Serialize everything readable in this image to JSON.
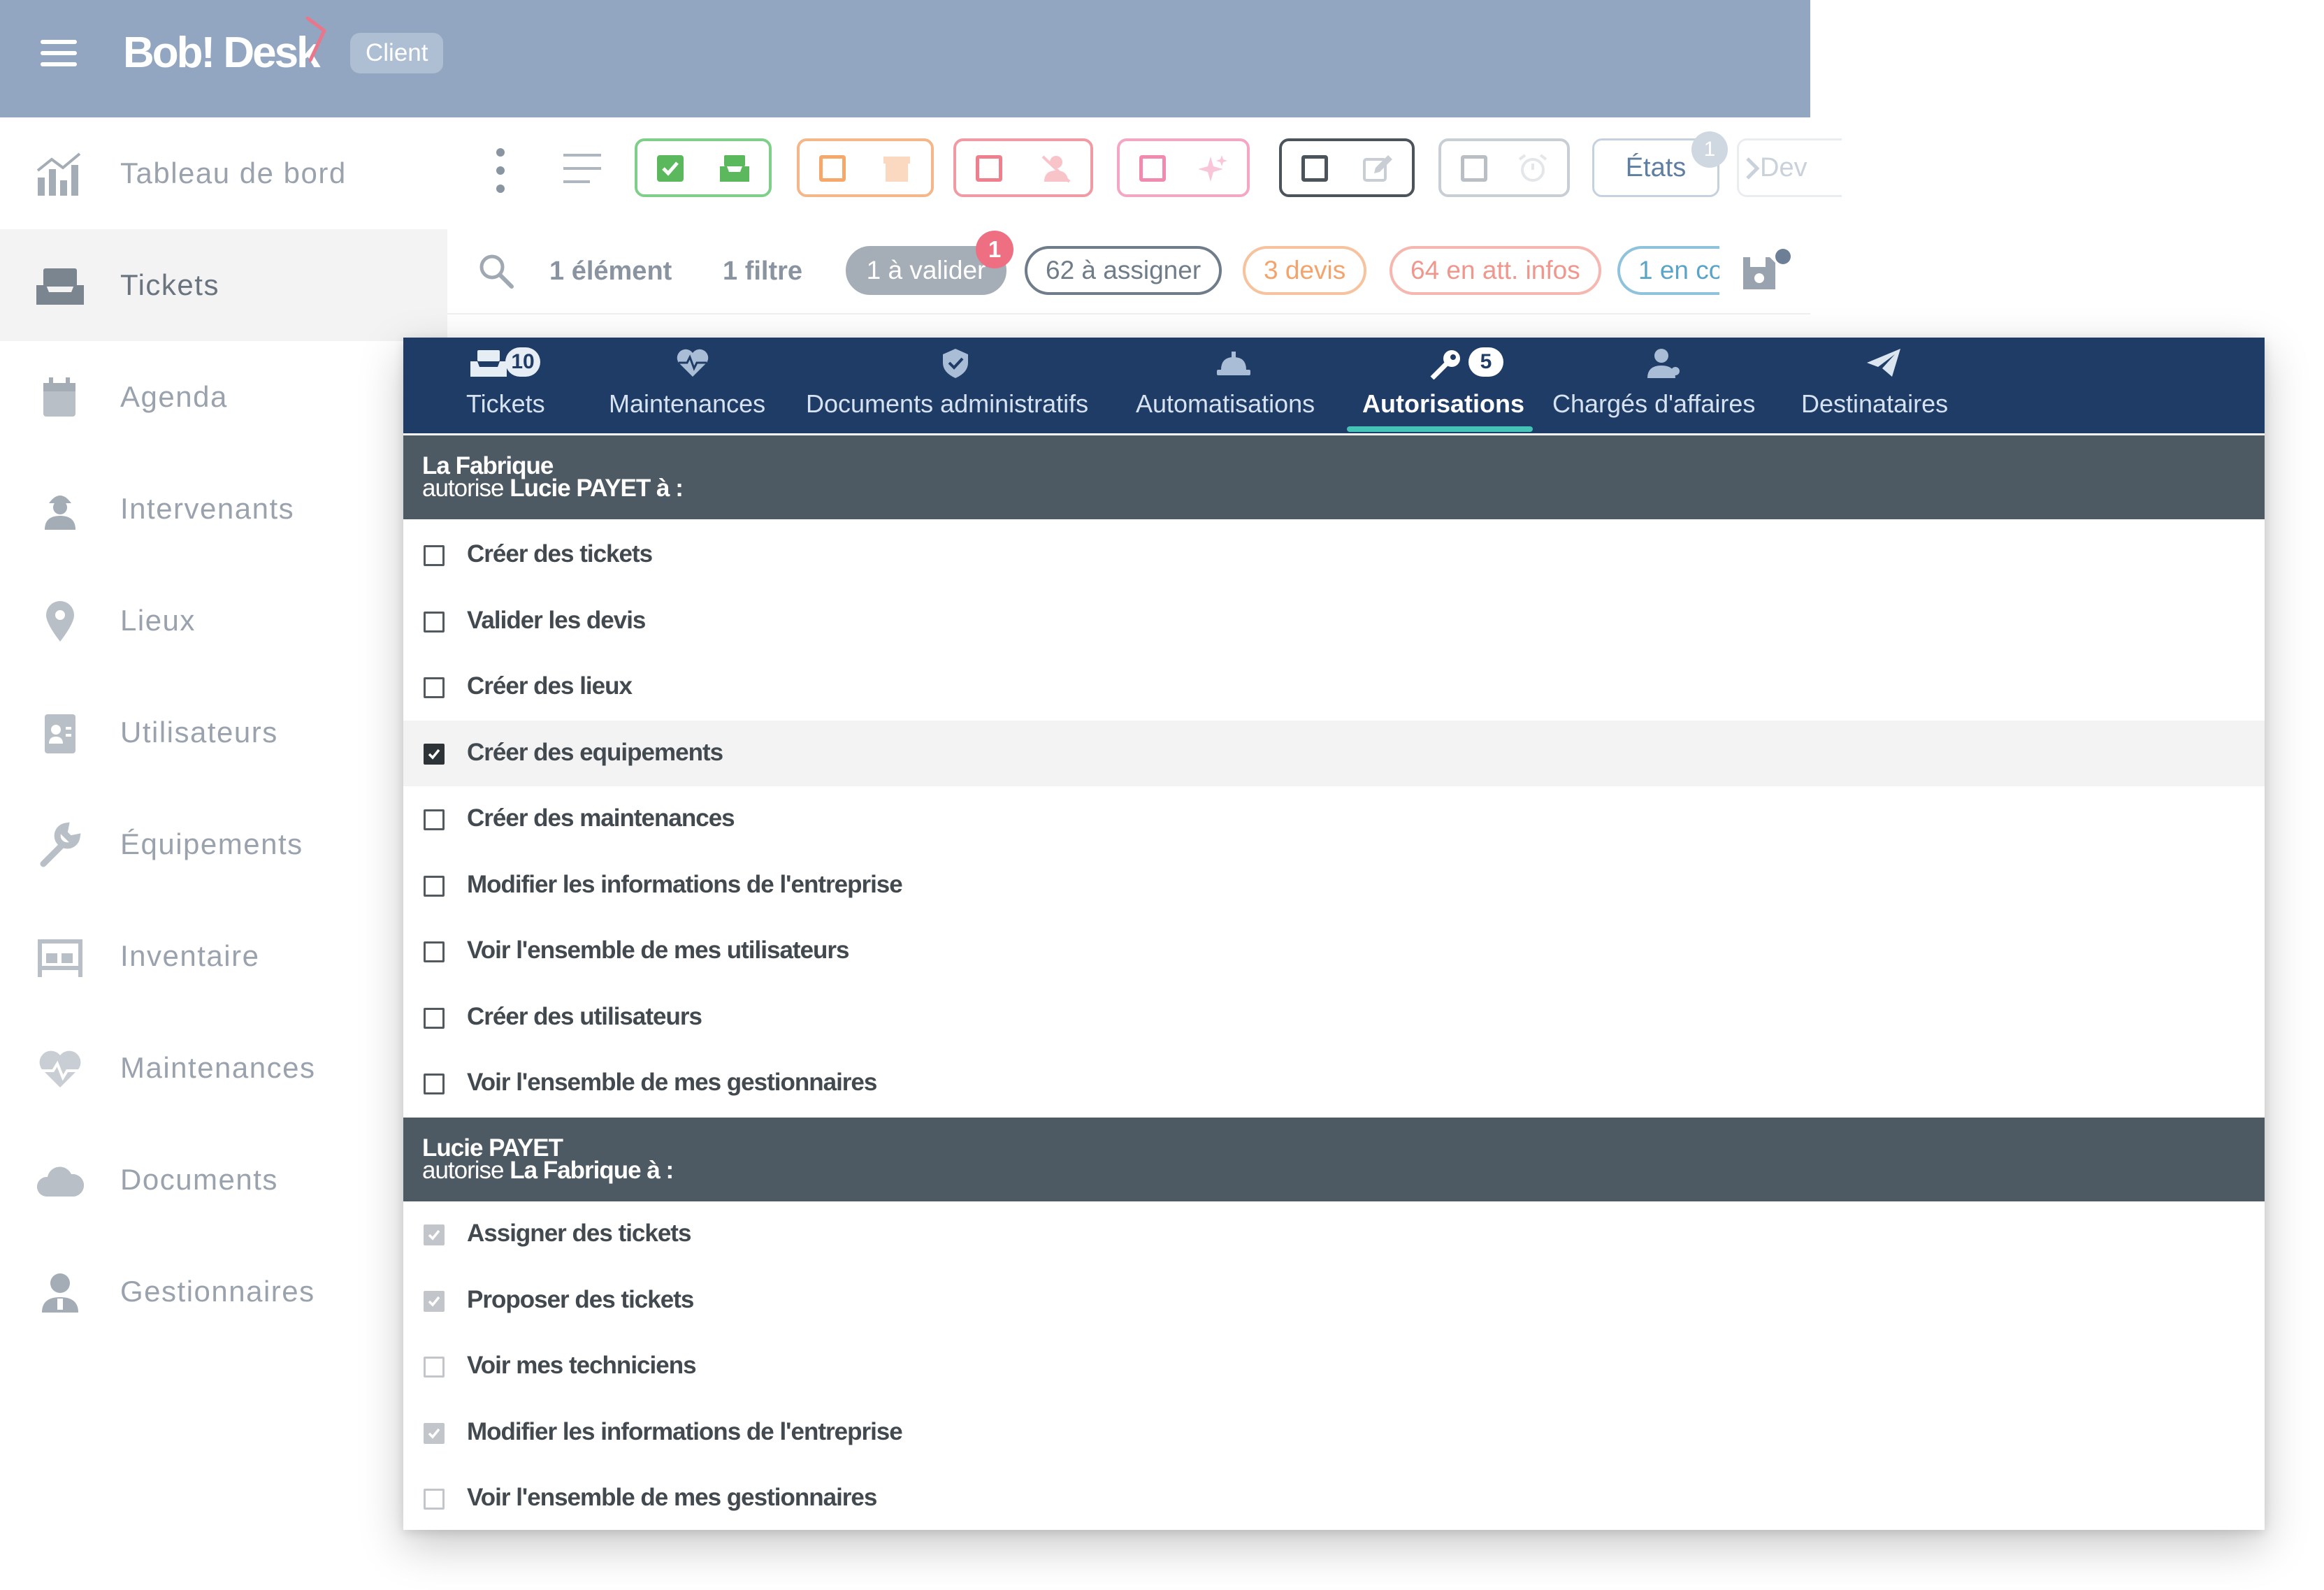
{
  "header": {
    "app_name": "Bob! Desk",
    "role_badge": "Client"
  },
  "sidebar": {
    "items": [
      {
        "label": "Tableau de bord",
        "icon": "bar-chart-icon"
      },
      {
        "label": "Tickets",
        "icon": "ticket-tray-icon",
        "active": true
      },
      {
        "label": "Agenda",
        "icon": "calendar-icon"
      },
      {
        "label": "Intervenants",
        "icon": "technician-icon"
      },
      {
        "label": "Lieux",
        "icon": "map-pin-icon"
      },
      {
        "label": "Utilisateurs",
        "icon": "user-card-icon"
      },
      {
        "label": "Équipements",
        "icon": "wrench-icon"
      },
      {
        "label": "Inventaire",
        "icon": "inventory-icon"
      },
      {
        "label": "Maintenances",
        "icon": "heartbeat-icon"
      },
      {
        "label": "Documents",
        "icon": "cloud-icon"
      },
      {
        "label": "Gestionnaires",
        "icon": "manager-icon"
      }
    ]
  },
  "toolbar": {
    "state_buttons": [
      {
        "name": "inbox-green",
        "color": "#5cb85c",
        "checked": true,
        "icon": "inbox-icon"
      },
      {
        "name": "archive-orange",
        "color": "#f5a86a",
        "checked": false,
        "icon": "archive-icon"
      },
      {
        "name": "unassigned-red",
        "color": "#ef7f8c",
        "checked": false,
        "icon": "user-slash-icon"
      },
      {
        "name": "new-pink",
        "color": "#f28ab0",
        "checked": false,
        "icon": "sparkle-icon"
      },
      {
        "name": "edit-dark",
        "color": "#4b535b",
        "checked": false,
        "icon": "edit-icon"
      },
      {
        "name": "alarm-grey",
        "color": "#b9bfc5",
        "checked": false,
        "icon": "alarm-clock-icon"
      }
    ],
    "etats_label": "États",
    "etats_count": "1",
    "dev_label": "Dev"
  },
  "filters": {
    "element_count": "1 élément",
    "filter_count": "1 filtre",
    "chips": [
      {
        "label": "1 à valider",
        "badge": "1"
      },
      {
        "label": "62 à assigner",
        "color": "#6f7c89"
      },
      {
        "label": "3 devis",
        "color": "#f3a46c"
      },
      {
        "label": "64 en att. infos",
        "color": "#f0968c"
      },
      {
        "label": "1 en co",
        "color": "#5aa4c8"
      }
    ]
  },
  "panel": {
    "tabs": [
      {
        "label": "Tickets",
        "badge": "10",
        "icon": "ticket-tray-icon"
      },
      {
        "label": "Maintenances",
        "icon": "heartbeat-icon"
      },
      {
        "label": "Documents administratifs",
        "icon": "shield-check-icon"
      },
      {
        "label": "Automatisations",
        "icon": "robot-icon"
      },
      {
        "label": "Autorisations",
        "badge": "5",
        "icon": "key-icon",
        "active": true
      },
      {
        "label": "Chargés d'affaires",
        "icon": "user-icon"
      },
      {
        "label": "Destinataires",
        "icon": "paper-plane-icon"
      }
    ],
    "section1": {
      "subject": "La Fabrique",
      "verb": "autorise",
      "object": "Lucie PAYET à :",
      "permissions": [
        {
          "label": "Créer des tickets",
          "checked": false
        },
        {
          "label": "Valider les devis",
          "checked": false
        },
        {
          "label": "Créer des lieux",
          "checked": false
        },
        {
          "label": "Créer des equipements",
          "checked": true
        },
        {
          "label": "Créer des maintenances",
          "checked": false
        },
        {
          "label": "Modifier les informations de l'entreprise",
          "checked": false
        },
        {
          "label": "Voir l'ensemble de mes utilisateurs",
          "checked": false
        },
        {
          "label": "Créer des utilisateurs",
          "checked": false
        },
        {
          "label": "Voir l'ensemble de mes gestionnaires",
          "checked": false
        }
      ]
    },
    "section2": {
      "subject": "Lucie PAYET",
      "verb": "autorise",
      "object": "La Fabrique à :",
      "permissions": [
        {
          "label": "Assigner des tickets",
          "checked": true
        },
        {
          "label": "Proposer des tickets",
          "checked": true
        },
        {
          "label": "Voir mes techniciens",
          "checked": false
        },
        {
          "label": "Modifier les informations de l'entreprise",
          "checked": true
        },
        {
          "label": "Voir l'ensemble de mes gestionnaires",
          "checked": false
        }
      ]
    }
  }
}
